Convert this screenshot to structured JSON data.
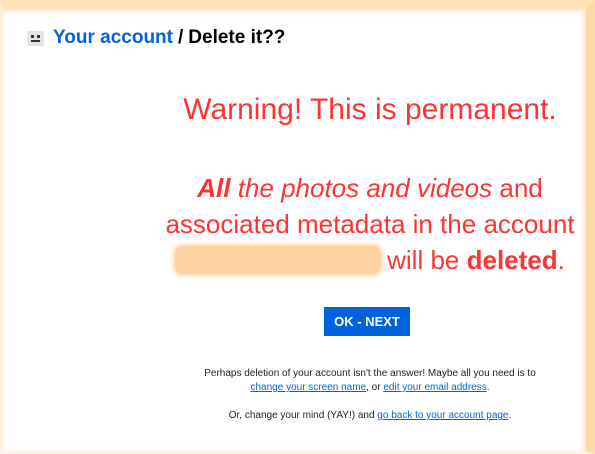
{
  "header": {
    "account_link": "Your account",
    "separator": "/",
    "current": "Delete it??"
  },
  "warning": {
    "title": "Warning! This is permanent.",
    "line1_bold": "All",
    "line1_italic": "the photos and videos",
    "line1_end": "and",
    "line2": "associated metadata in the account",
    "line3_pre": "will be",
    "line3_bold": "deleted",
    "line3_end": "."
  },
  "actions": {
    "ok_label": "OK - NEXT"
  },
  "suggestions": {
    "line1": "Perhaps deletion of your account isn't the answer! Maybe all you need is to",
    "change_screen_name": "change your screen name",
    "or_text": ", or",
    "edit_email": "edit your email address",
    "period": "."
  },
  "alternative": {
    "text": "Or, change your mind (YAY!) and",
    "back_link": "go back to your account page",
    "period": "."
  },
  "colors": {
    "link_blue": "#0063dc",
    "warning_red": "#ff3333",
    "redaction": "#ffd3a1"
  }
}
